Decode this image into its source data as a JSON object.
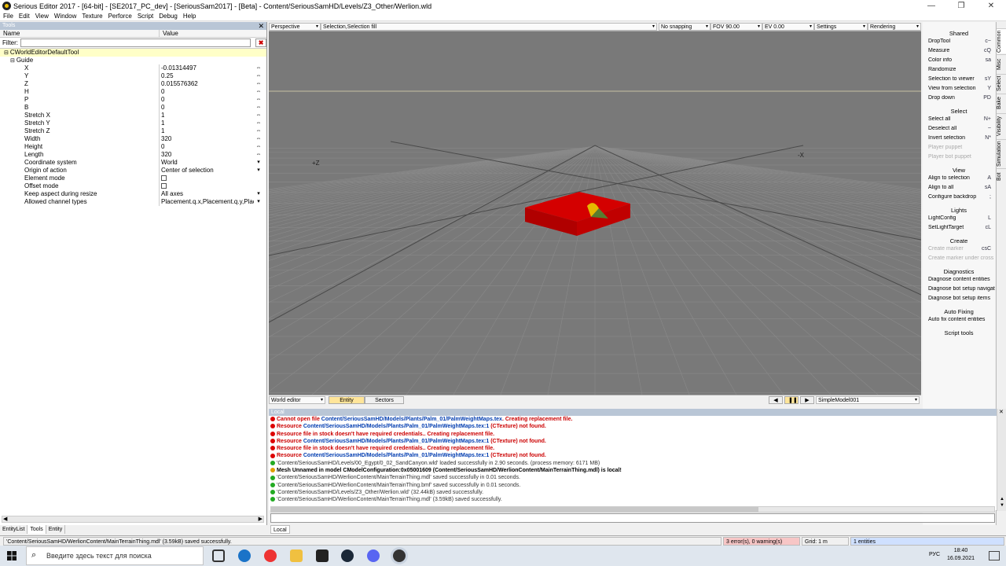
{
  "window": {
    "title": "Serious Editor 2017 - [64-bit] - [SE2017_PC_dev] - [SeriousSam2017] - [Beta] - Content/SeriousSamHD/Levels/Z3_Other/Werlion.wld",
    "minimize": "—",
    "maximize": "❐",
    "close": "✕"
  },
  "menu": [
    "File",
    "Edit",
    "View",
    "Window",
    "Texture",
    "Perforce",
    "Script",
    "Debug",
    "Help"
  ],
  "tools": {
    "title": "Tools",
    "col_name": "Name",
    "col_value": "Value",
    "filter_label": "Filter:",
    "filter_value": "",
    "filter_clear": "✖",
    "class_row": "CWorldEditorDefaultTool",
    "group_row": "Guide",
    "props": [
      {
        "name": "X",
        "value": "-0.01314497",
        "arrow": "⇔"
      },
      {
        "name": "Y",
        "value": "0.25",
        "arrow": "⇔"
      },
      {
        "name": "Z",
        "value": "0.015576362",
        "arrow": "⇔"
      },
      {
        "name": "H",
        "value": "0",
        "arrow": "⇔"
      },
      {
        "name": "P",
        "value": "0",
        "arrow": "⇔"
      },
      {
        "name": "B",
        "value": "0",
        "arrow": "⇔"
      },
      {
        "name": "Stretch X",
        "value": "1",
        "arrow": "⇔"
      },
      {
        "name": "Stretch Y",
        "value": "1",
        "arrow": "⇔"
      },
      {
        "name": "Stretch Z",
        "value": "1",
        "arrow": "⇔"
      },
      {
        "name": "Width",
        "value": "320",
        "arrow": "⇔"
      },
      {
        "name": "Height",
        "value": "0",
        "arrow": "⇔"
      },
      {
        "name": "Length",
        "value": "320",
        "arrow": "⇔"
      },
      {
        "name": "Coordinate system",
        "value": "World",
        "arrow": "▾"
      },
      {
        "name": "Origin of action",
        "value": "Center of selection",
        "arrow": "▾"
      },
      {
        "name": "Element mode",
        "value": "",
        "arrow": ""
      },
      {
        "name": "Offset mode",
        "value": "",
        "arrow": ""
      },
      {
        "name": "Keep aspect during resize",
        "value": "All axes",
        "arrow": "▾"
      },
      {
        "name": "Allowed channel types",
        "value": "Placement.q.x,Placement.q.y,Place...",
        "arrow": "▾"
      }
    ],
    "tabs": [
      "EntityList",
      "Tools",
      "Entity"
    ]
  },
  "viewport": {
    "projection": "Perspective",
    "selection": "Selection,Selection fill",
    "snapping": "No snapping",
    "fov": "FOV 90.00",
    "ev": "EV 0.00",
    "settings": "Settings",
    "rendering": "Rendering",
    "axis_z": "+Z",
    "axis_x": "-X",
    "mode": "World editor",
    "tab_entity": "Entity",
    "tab_sectors": "Sectors",
    "prev": "◀",
    "pause": "❚❚",
    "next": "▶",
    "model": "SimpleModel001"
  },
  "right": {
    "tabs": [
      "Common",
      "Misc",
      "Select",
      "Bake",
      "Visibility",
      "Simulation",
      "Bot"
    ],
    "sections": [
      {
        "title": "Shared",
        "items": [
          {
            "label": "DropTool",
            "key": "c~"
          },
          {
            "label": "Measure",
            "key": "cQ"
          },
          {
            "label": "Color info",
            "key": "sa"
          },
          {
            "label": "Randomize",
            "key": ""
          },
          {
            "label": "Selection to viewer",
            "key": "sY"
          },
          {
            "label": "View from selection",
            "key": "Y"
          },
          {
            "label": "Drop down",
            "key": "PD"
          }
        ]
      },
      {
        "title": "Select",
        "items": [
          {
            "label": "Select all",
            "key": "N+"
          },
          {
            "label": "Deselect all",
            "key": "~"
          },
          {
            "label": "Invert selection",
            "key": "N*"
          },
          {
            "label": "Player puppet",
            "key": "",
            "dis": true
          },
          {
            "label": "Player bot puppet",
            "key": "",
            "dis": true
          }
        ]
      },
      {
        "title": "View",
        "items": [
          {
            "label": "Align to selection",
            "key": "A"
          },
          {
            "label": "Align to all",
            "key": "sA"
          },
          {
            "label": "Configure backdrop",
            "key": ";"
          }
        ]
      },
      {
        "title": "Lights",
        "items": [
          {
            "label": "LightConfig",
            "key": "L"
          },
          {
            "label": "SetLightTarget",
            "key": "cL"
          }
        ]
      },
      {
        "title": "Create",
        "items": [
          {
            "label": "Create marker",
            "key": "csC",
            "dis": true
          },
          {
            "label": "Create marker under cross",
            "key": "",
            "dis": true
          }
        ]
      },
      {
        "title": "Diagnostics",
        "items": [
          {
            "label": "Diagnose content entities",
            "key": ""
          },
          {
            "label": "Diagnose bot setup navigation",
            "key": ""
          },
          {
            "label": "Diagnose bot setup items",
            "key": ""
          }
        ]
      },
      {
        "title": "Auto Fixing",
        "items": [
          {
            "label": "Auto fix content entities",
            "key": ""
          }
        ]
      },
      {
        "title": "Script tools",
        "items": []
      }
    ]
  },
  "log": {
    "title": "Local",
    "lines": [
      {
        "t": "err",
        "a": "Cannot open file ",
        "b": "Content/SeriousSamHD/Models/Plants/Palm_01/PalmWeightMaps.tex",
        "c": ". Creating replacement file."
      },
      {
        "t": "err",
        "a": "Resource ",
        "b": "Content/SeriousSamHD/Models/Plants/Palm_01/PalmWeightMaps.tex:1",
        "c": " (CTexture) not found."
      },
      {
        "t": "err",
        "a": "Resource file in stock doesn't have required credentials.. Creating replacement file.",
        "b": "",
        "c": ""
      },
      {
        "t": "err",
        "a": "Resource ",
        "b": "Content/SeriousSamHD/Models/Plants/Palm_01/PalmWeightMaps.tex:1",
        "c": " (CTexture) not found."
      },
      {
        "t": "err",
        "a": "Resource file in stock doesn't have required credentials.. Creating replacement file.",
        "b": "",
        "c": ""
      },
      {
        "t": "err",
        "a": "Resource ",
        "b": "Content/SeriousSamHD/Models/Plants/Palm_01/PalmWeightMaps.tex:1",
        "c": " (CTexture) not found."
      },
      {
        "t": "ok",
        "a": "'Content/SeriousSamHD/Levels/00_Egypt/0_02_SandCanyon.wld' loaded successfully in 2.90 seconds. (process memory: 6171 MB)",
        "b": "",
        "c": ""
      },
      {
        "t": "warn",
        "a": "Mesh Unnamed in model CModelConfiguration:0x05001609 (Content/SeriousSamHD/WerlionContent/MainTerrainThing.mdl) is local!",
        "b": "",
        "c": ""
      },
      {
        "t": "ok",
        "a": "'Content/SeriousSamHD/WerlionContent/MainTerrainThing.mdl' saved successfully in 0.01 seconds.",
        "b": "",
        "c": ""
      },
      {
        "t": "ok",
        "a": "'Content/SeriousSamHD/WerlionContent/MainTerrainThing.bmf' saved successfully in 0.01 seconds.",
        "b": "",
        "c": ""
      },
      {
        "t": "ok",
        "a": "'Content/SeriousSamHD/Levels/Z3_Other/Werlion.wld' (32.44kB) saved successfully.",
        "b": "",
        "c": ""
      },
      {
        "t": "ok",
        "a": "'Content/SeriousSamHD/WerlionContent/MainTerrainThing.mdl' (3.59kB) saved successfully.",
        "b": "",
        "c": ""
      }
    ],
    "tab": "Local"
  },
  "status": {
    "message": "'Content/SeriousSamHD/WerlionContent/MainTerrainThing.mdl' (3.59kB) saved successfully.",
    "errors": "3 error(s), 0 warning(s)",
    "grid": "Grid: 1 m",
    "entities": "1 entities"
  },
  "taskbar": {
    "search_placeholder": "Введите здесь текст для поиска",
    "lang": "РУС",
    "time": "18:40",
    "date": "16.09.2021"
  }
}
